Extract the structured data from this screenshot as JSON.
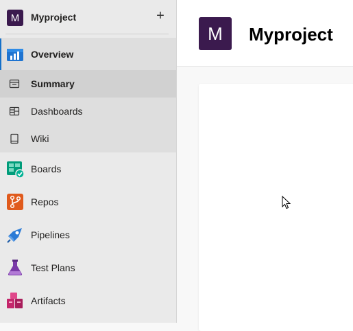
{
  "project": {
    "initial": "M",
    "name": "Myproject",
    "add_symbol": "+"
  },
  "nav": {
    "overview": {
      "label": "Overview",
      "icon": "overview-icon"
    },
    "sub_items": [
      {
        "label": "Summary",
        "icon": "summary-icon",
        "selected": true
      },
      {
        "label": "Dashboards",
        "icon": "dashboards-icon",
        "selected": false
      },
      {
        "label": "Wiki",
        "icon": "wiki-icon",
        "selected": false
      }
    ],
    "items": [
      {
        "label": "Boards",
        "icon": "boards-icon"
      },
      {
        "label": "Repos",
        "icon": "repos-icon"
      },
      {
        "label": "Pipelines",
        "icon": "pipelines-icon"
      },
      {
        "label": "Test Plans",
        "icon": "test-plans-icon"
      },
      {
        "label": "Artifacts",
        "icon": "artifacts-icon"
      }
    ]
  },
  "main": {
    "avatar_initial": "M",
    "title": "Myproject"
  },
  "colors": {
    "project_avatar": "#3b1a4e",
    "active_accent": "#1570c9",
    "overview": "#1e74d1",
    "boards": "#009c7a",
    "repos": "#e05a1c",
    "pipelines": "#2b7bd6",
    "test_plans": "#7a3aa8",
    "artifacts": "#c4266b"
  }
}
